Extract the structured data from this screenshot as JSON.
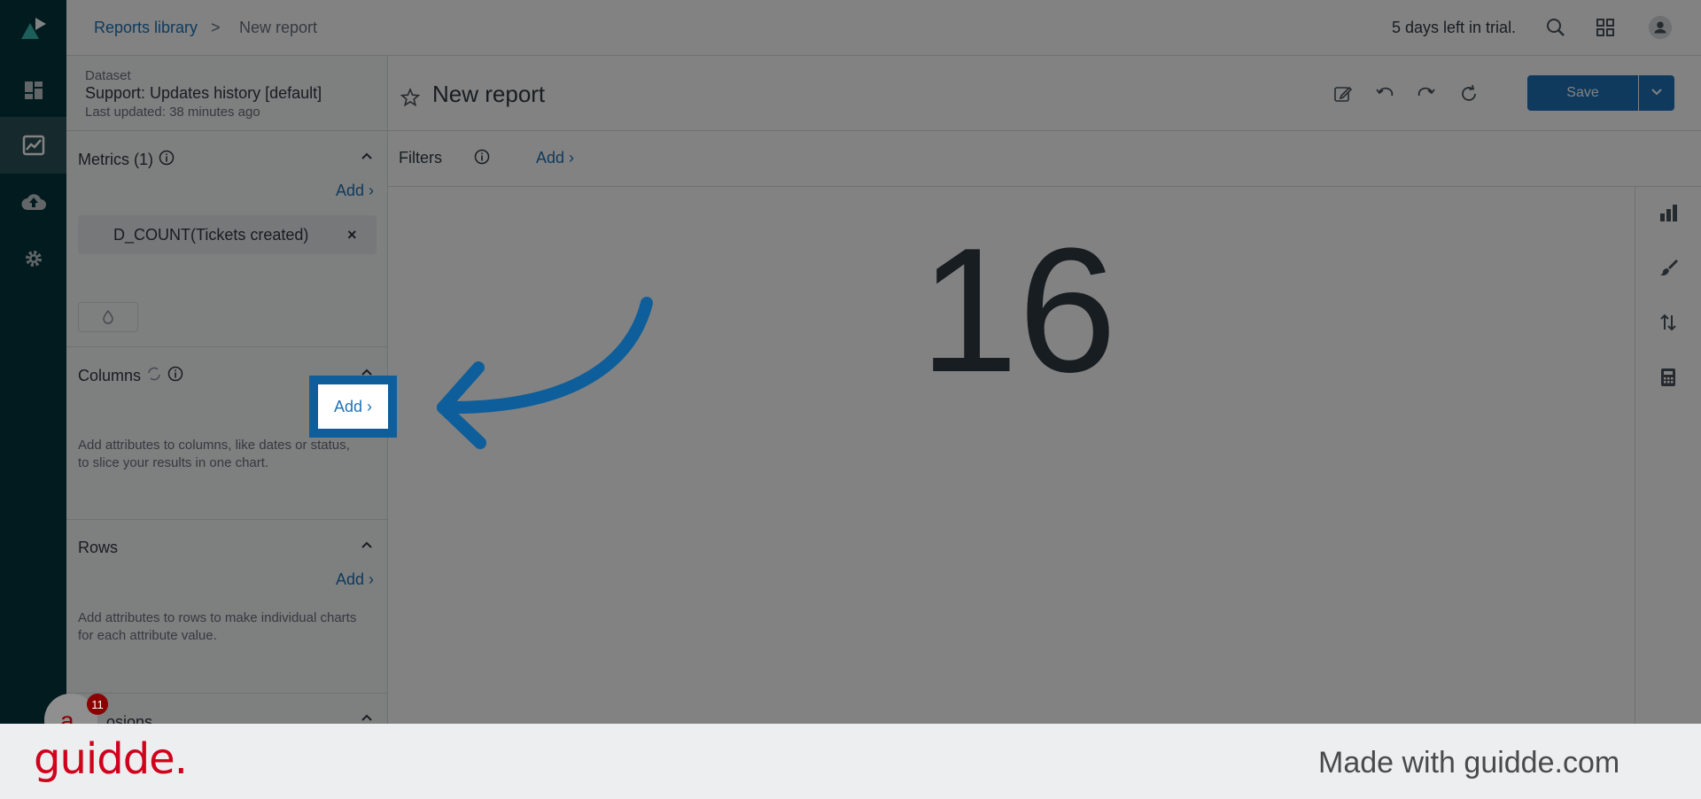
{
  "breadcrumb": {
    "root": "Reports library",
    "separator": ">",
    "current": "New report"
  },
  "header": {
    "trial_text": "5 days left in trial."
  },
  "dataset": {
    "label": "Dataset",
    "name": "Support: Updates history [default]",
    "updated": "Last updated: 38 minutes ago"
  },
  "metrics": {
    "title": "Metrics (1)",
    "add_label": "Add ›",
    "items": [
      {
        "label": "D_COUNT(Tickets created)",
        "remove": "×"
      }
    ]
  },
  "columns": {
    "title": "Columns",
    "add_label": "Add ›",
    "help": "Add attributes to columns, like dates or status, to slice your results in one chart."
  },
  "rows": {
    "title": "Rows",
    "add_label": "Add ›",
    "help": "Add attributes to rows to make individual charts for each attribute value."
  },
  "explosions": {
    "title": "osions"
  },
  "report": {
    "title": "New report",
    "save_label": "Save"
  },
  "filters": {
    "label": "Filters",
    "add_label": "Add ›"
  },
  "result": {
    "value": "16"
  },
  "badge": {
    "count": "11"
  },
  "footer": {
    "brand": "guidde.",
    "made_with": "Made with guidde.com"
  },
  "colors": {
    "accent": "#1f73b7",
    "nav": "#03363d",
    "highlight": "#0d5e9a",
    "brand": "#d0021b"
  },
  "icons": [
    "zendesk-logo-icon",
    "dashboard-icon",
    "reports-icon",
    "upload-icon",
    "settings-icon",
    "search-icon",
    "apps-grid-icon",
    "user-avatar-icon",
    "star-icon",
    "edit-icon",
    "undo-icon",
    "redo-icon",
    "refresh-icon",
    "chevron-down-icon",
    "info-icon",
    "chevron-up-icon",
    "swap-icon",
    "bar-chart-icon",
    "paintbrush-icon",
    "sort-icon",
    "calculator-icon"
  ]
}
